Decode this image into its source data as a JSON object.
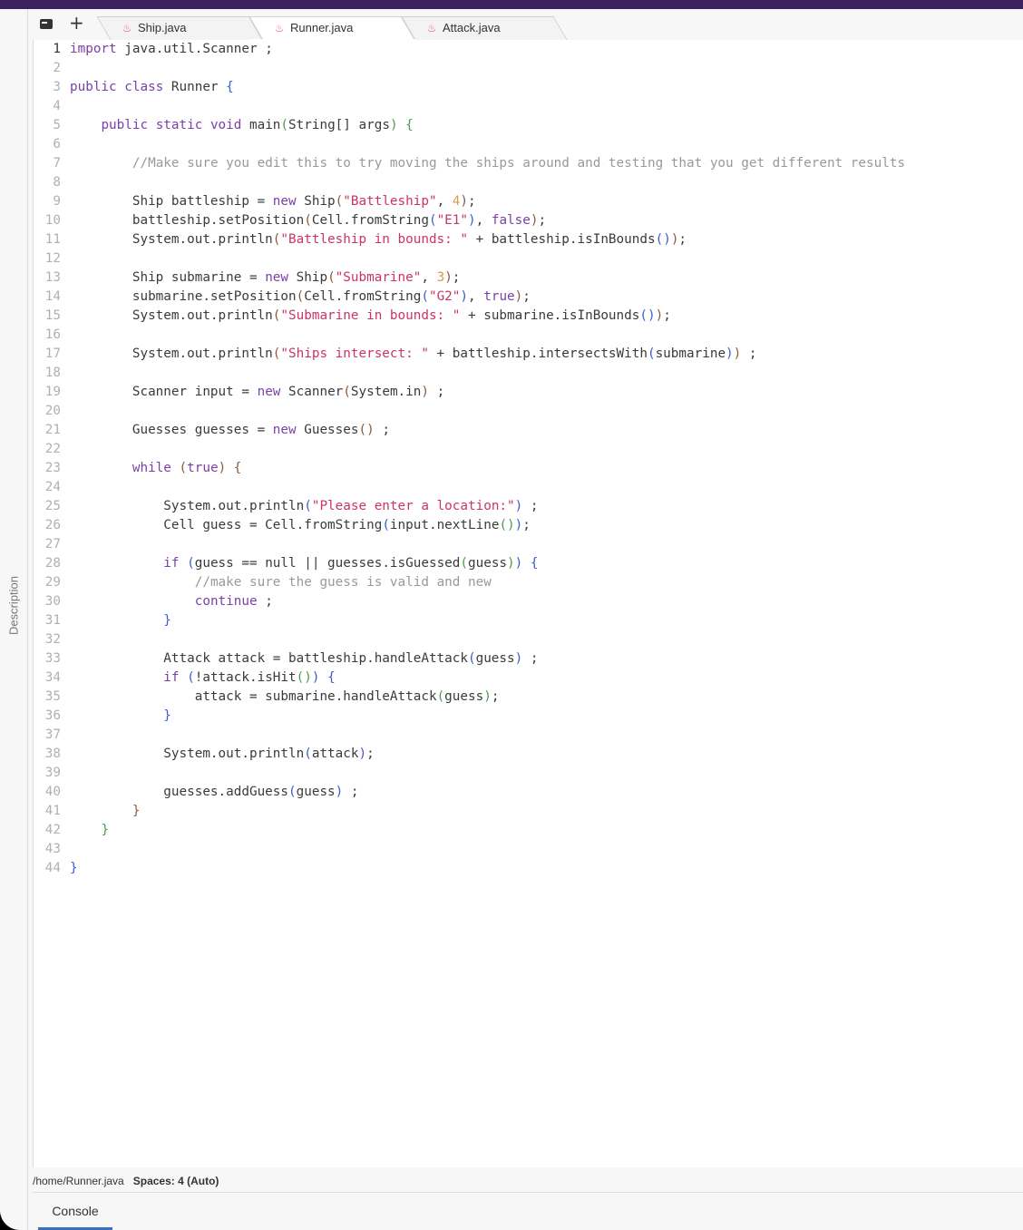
{
  "sidebar": {
    "label": "Description"
  },
  "toolbar": {
    "files_icon": "files-panel-icon",
    "add_icon": "+"
  },
  "tabs": [
    {
      "label": "Ship.java",
      "icon": "java-icon",
      "active": false
    },
    {
      "label": "Runner.java",
      "icon": "java-icon",
      "active": true
    },
    {
      "label": "Attack.java",
      "icon": "java-icon",
      "active": false
    }
  ],
  "editor": {
    "active_line": 1,
    "lines": [
      [
        [
          "kw",
          "import"
        ],
        [
          "t",
          " java.util.Scanner ;"
        ]
      ],
      [],
      [
        [
          "kw",
          "public class"
        ],
        [
          "t",
          " Runner "
        ],
        [
          "b0",
          "{"
        ]
      ],
      [],
      [
        [
          "t",
          "    "
        ],
        [
          "kw",
          "public static void"
        ],
        [
          "t",
          " main"
        ],
        [
          "b1",
          "("
        ],
        [
          "t",
          "String[] args"
        ],
        [
          "b1",
          ")"
        ],
        [
          "t",
          " "
        ],
        [
          "b1",
          "{"
        ]
      ],
      [],
      [
        [
          "t",
          "        "
        ],
        [
          "cmt",
          "//Make sure you edit this to try moving the ships around and testing that you get different results"
        ]
      ],
      [],
      [
        [
          "t",
          "        Ship battleship = "
        ],
        [
          "kw",
          "new"
        ],
        [
          "t",
          " Ship"
        ],
        [
          "b2",
          "("
        ],
        [
          "str",
          "\"Battleship\""
        ],
        [
          "t",
          ", "
        ],
        [
          "numlit",
          "4"
        ],
        [
          "b2",
          ")"
        ],
        [
          "t",
          ";"
        ]
      ],
      [
        [
          "t",
          "        battleship.setPosition"
        ],
        [
          "b2",
          "("
        ],
        [
          "t",
          "Cell.fromString"
        ],
        [
          "b0",
          "("
        ],
        [
          "str",
          "\"E1\""
        ],
        [
          "b0",
          ")"
        ],
        [
          "t",
          ", "
        ],
        [
          "kw",
          "false"
        ],
        [
          "b2",
          ")"
        ],
        [
          "t",
          ";"
        ]
      ],
      [
        [
          "t",
          "        System.out.println"
        ],
        [
          "b2",
          "("
        ],
        [
          "str",
          "\"Battleship in bounds: \""
        ],
        [
          "t",
          " + battleship.isInBounds"
        ],
        [
          "b0",
          "()"
        ],
        [
          "b2",
          ")"
        ],
        [
          "t",
          ";"
        ]
      ],
      [],
      [
        [
          "t",
          "        Ship submarine = "
        ],
        [
          "kw",
          "new"
        ],
        [
          "t",
          " Ship"
        ],
        [
          "b2",
          "("
        ],
        [
          "str",
          "\"Submarine\""
        ],
        [
          "t",
          ", "
        ],
        [
          "numlit",
          "3"
        ],
        [
          "b2",
          ")"
        ],
        [
          "t",
          ";"
        ]
      ],
      [
        [
          "t",
          "        submarine.setPosition"
        ],
        [
          "b2",
          "("
        ],
        [
          "t",
          "Cell.fromString"
        ],
        [
          "b0",
          "("
        ],
        [
          "str",
          "\"G2\""
        ],
        [
          "b0",
          ")"
        ],
        [
          "t",
          ", "
        ],
        [
          "kw",
          "true"
        ],
        [
          "b2",
          ")"
        ],
        [
          "t",
          ";"
        ]
      ],
      [
        [
          "t",
          "        System.out.println"
        ],
        [
          "b2",
          "("
        ],
        [
          "str",
          "\"Submarine in bounds: \""
        ],
        [
          "t",
          " + submarine.isInBounds"
        ],
        [
          "b0",
          "()"
        ],
        [
          "b2",
          ")"
        ],
        [
          "t",
          ";"
        ]
      ],
      [],
      [
        [
          "t",
          "        System.out.println"
        ],
        [
          "b2",
          "("
        ],
        [
          "str",
          "\"Ships intersect: \""
        ],
        [
          "t",
          " + battleship.intersectsWith"
        ],
        [
          "b0",
          "("
        ],
        [
          "t",
          "submarine"
        ],
        [
          "b0",
          ")"
        ],
        [
          "b2",
          ")"
        ],
        [
          "t",
          " ;"
        ]
      ],
      [],
      [
        [
          "t",
          "        Scanner input = "
        ],
        [
          "kw",
          "new"
        ],
        [
          "t",
          " Scanner"
        ],
        [
          "b2",
          "("
        ],
        [
          "t",
          "System.in"
        ],
        [
          "b2",
          ")"
        ],
        [
          "t",
          " ;"
        ]
      ],
      [],
      [
        [
          "t",
          "        Guesses guesses = "
        ],
        [
          "kw",
          "new"
        ],
        [
          "t",
          " Guesses"
        ],
        [
          "b2",
          "()"
        ],
        [
          "t",
          " ;"
        ]
      ],
      [],
      [
        [
          "t",
          "        "
        ],
        [
          "kw",
          "while"
        ],
        [
          "t",
          " "
        ],
        [
          "b2",
          "("
        ],
        [
          "kw",
          "true"
        ],
        [
          "b2",
          ")"
        ],
        [
          "t",
          " "
        ],
        [
          "b2",
          "{"
        ]
      ],
      [],
      [
        [
          "t",
          "            System.out.println"
        ],
        [
          "b0",
          "("
        ],
        [
          "str",
          "\"Please enter a location:\""
        ],
        [
          "b0",
          ")"
        ],
        [
          "t",
          " ;"
        ]
      ],
      [
        [
          "t",
          "            Cell guess = Cell.fromString"
        ],
        [
          "b0",
          "("
        ],
        [
          "t",
          "input.nextLine"
        ],
        [
          "b1",
          "()"
        ],
        [
          "b0",
          ")"
        ],
        [
          "t",
          ";"
        ]
      ],
      [],
      [
        [
          "t",
          "            "
        ],
        [
          "kw",
          "if"
        ],
        [
          "t",
          " "
        ],
        [
          "b0",
          "("
        ],
        [
          "t",
          "guess == null || guesses.isGuessed"
        ],
        [
          "b1",
          "("
        ],
        [
          "t",
          "guess"
        ],
        [
          "b1",
          ")"
        ],
        [
          "b0",
          ")"
        ],
        [
          "t",
          " "
        ],
        [
          "b0",
          "{"
        ]
      ],
      [
        [
          "t",
          "                "
        ],
        [
          "cmt",
          "//make sure the guess is valid and new"
        ]
      ],
      [
        [
          "t",
          "                "
        ],
        [
          "kw",
          "continue"
        ],
        [
          "t",
          " ;"
        ]
      ],
      [
        [
          "t",
          "            "
        ],
        [
          "b0",
          "}"
        ]
      ],
      [],
      [
        [
          "t",
          "            Attack attack = battleship.handleAttack"
        ],
        [
          "b0",
          "("
        ],
        [
          "t",
          "guess"
        ],
        [
          "b0",
          ")"
        ],
        [
          "t",
          " ;"
        ]
      ],
      [
        [
          "t",
          "            "
        ],
        [
          "kw",
          "if"
        ],
        [
          "t",
          " "
        ],
        [
          "b0",
          "("
        ],
        [
          "t",
          "!attack.isHit"
        ],
        [
          "b1",
          "()"
        ],
        [
          "b0",
          ")"
        ],
        [
          "t",
          " "
        ],
        [
          "b0",
          "{"
        ]
      ],
      [
        [
          "t",
          "                attack = submarine.handleAttack"
        ],
        [
          "b1",
          "("
        ],
        [
          "t",
          "guess"
        ],
        [
          "b1",
          ")"
        ],
        [
          "t",
          ";"
        ]
      ],
      [
        [
          "t",
          "            "
        ],
        [
          "b0",
          "}"
        ]
      ],
      [],
      [
        [
          "t",
          "            System.out.println"
        ],
        [
          "b0",
          "("
        ],
        [
          "t",
          "attack"
        ],
        [
          "b0",
          ")"
        ],
        [
          "t",
          ";"
        ]
      ],
      [],
      [
        [
          "t",
          "            guesses.addGuess"
        ],
        [
          "b0",
          "("
        ],
        [
          "t",
          "guess"
        ],
        [
          "b0",
          ")"
        ],
        [
          "t",
          " ;"
        ]
      ],
      [
        [
          "t",
          "        "
        ],
        [
          "b2",
          "}"
        ]
      ],
      [
        [
          "t",
          "    "
        ],
        [
          "b1",
          "}"
        ]
      ],
      [],
      [
        [
          "b0",
          "}"
        ]
      ]
    ]
  },
  "status": {
    "path": "/home/Runner.java",
    "spaces": "Spaces: 4 (Auto)"
  },
  "bottom": {
    "tabs": [
      {
        "label": "Console",
        "active": true
      }
    ]
  }
}
